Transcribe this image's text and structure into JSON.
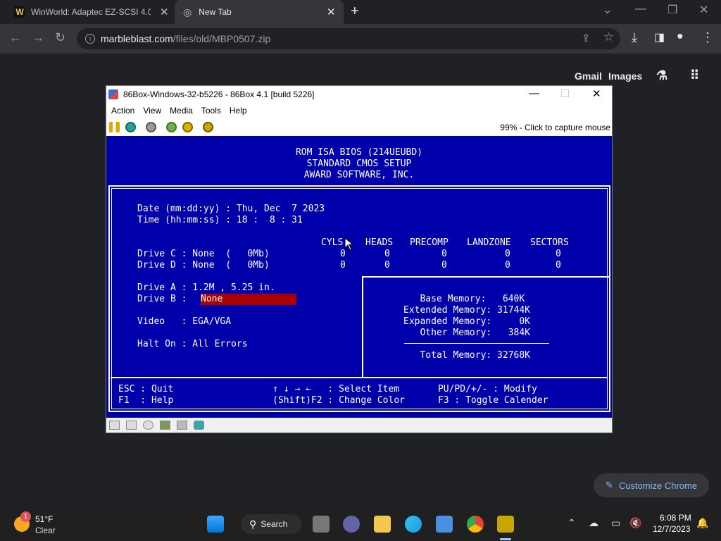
{
  "browser": {
    "tabs": [
      {
        "title": "WinWorld: Adaptec EZ-SCSI 4.0…",
        "active": false
      },
      {
        "title": "New Tab",
        "active": true
      }
    ],
    "url_host": "marbleblast.com",
    "url_path": "/files/old/MBP0507.zip",
    "ntp_links": [
      "Gmail",
      "Images"
    ],
    "customize_label": "Customize Chrome"
  },
  "vm_window": {
    "title": "86Box-Windows-32-b5226 - 86Box 4.1 [build 5226]",
    "menu": [
      "Action",
      "View",
      "Media",
      "Tools",
      "Help"
    ],
    "status_text": "99% - Click to capture mouse"
  },
  "bios": {
    "header": [
      "ROM ISA BIOS (214UEUBD)",
      "STANDARD CMOS SETUP",
      "AWARD SOFTWARE, INC."
    ],
    "date_line": "Date (mm:dd:yy) : Thu, Dec  7 2023",
    "time_line": "Time (hh:mm:ss) : 18 :  8 : 31",
    "drive_columns": [
      "CYLS",
      "HEADS",
      "PRECOMP",
      "LANDZONE",
      "SECTORS"
    ],
    "drives": [
      {
        "label": "Drive C : None  (   0Mb)",
        "cyls": "0",
        "heads": "0",
        "precomp": "0",
        "landzone": "0",
        "sectors": "0"
      },
      {
        "label": "Drive D : None  (   0Mb)",
        "cyls": "0",
        "heads": "0",
        "precomp": "0",
        "landzone": "0",
        "sectors": "0"
      }
    ],
    "drive_a": "Drive A : 1.2M , 5.25 in.",
    "drive_b_label": "Drive B : ",
    "drive_b_value": "None",
    "video": "Video   : EGA/VGA",
    "halt_on": "Halt On : All Errors",
    "memory": [
      "   Base Memory:   640K",
      "Extended Memory: 31744K",
      "Expanded Memory:     0K",
      "   Other Memory:   384K"
    ],
    "total_memory": "   Total Memory: 32768K",
    "help_lines": [
      "ESC : Quit                  ↑ ↓ → ←   : Select Item       PU/PD/+/- : Modify",
      "F1  : Help                  (Shift)F2 : Change Color      F3 : Toggle Calender"
    ]
  },
  "taskbar": {
    "weather_temp": "51°F",
    "weather_desc": "Clear",
    "weather_badge": "1",
    "search_label": "Search",
    "time": "6:08 PM",
    "date": "12/7/2023"
  }
}
